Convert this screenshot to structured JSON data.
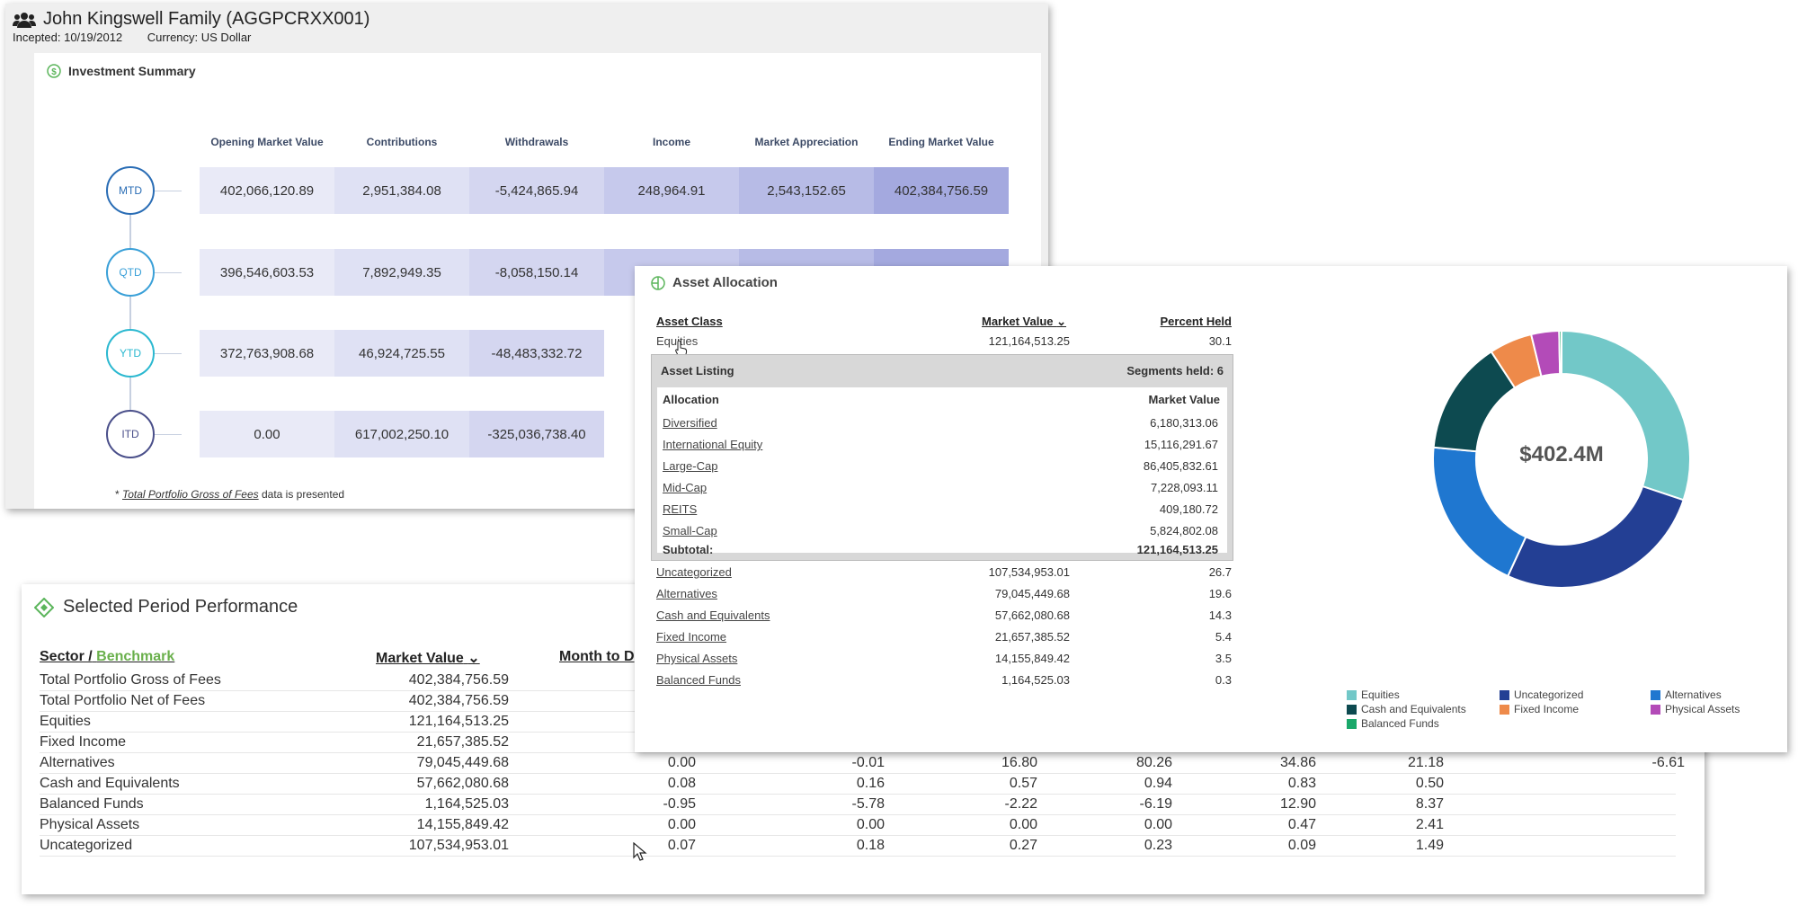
{
  "header": {
    "title": "John Kingswell Family (AGGPCRXX001)",
    "incepted": "Incepted: 10/19/2012",
    "currency": "Currency: US Dollar"
  },
  "investment_summary": {
    "title": "Investment Summary",
    "columns": [
      "Opening Market Value",
      "Contributions",
      "Withdrawals",
      "Income",
      "Market Appreciation",
      "Ending Market Value"
    ],
    "rows": [
      {
        "label": "MTD",
        "values": [
          "402,066,120.89",
          "2,951,384.08",
          "-5,424,865.94",
          "248,964.91",
          "2,543,152.65",
          "402,384,756.59"
        ]
      },
      {
        "label": "QTD",
        "values": [
          "396,546,603.53",
          "7,892,949.35",
          "-8,058,150.14"
        ]
      },
      {
        "label": "YTD",
        "values": [
          "372,763,908.68",
          "46,924,725.55",
          "-48,483,332.72"
        ]
      },
      {
        "label": "ITD",
        "values": [
          "0.00",
          "617,002,250.10",
          "-325,036,738.40"
        ]
      }
    ],
    "footnote_prefix": "* ",
    "footnote_link": "Total Portfolio Gross of Fees",
    "footnote_suffix": " data is presented"
  },
  "asset_allocation": {
    "title": "Asset Allocation",
    "headers": {
      "asset_class": "Asset Class",
      "market_value": "Market Value",
      "percent_held": "Percent Held"
    },
    "equities": {
      "name": "Equities",
      "mv": "121,164,513.25",
      "pct": "30.1"
    },
    "listing": {
      "title": "Asset Listing",
      "segments": "Segments held: 6",
      "col_alloc": "Allocation",
      "col_mv": "Market Value",
      "rows": [
        {
          "name": "Diversified",
          "mv": "6,180,313.06"
        },
        {
          "name": "International Equity",
          "mv": "15,116,291.67"
        },
        {
          "name": "Large-Cap",
          "mv": "86,405,832.61"
        },
        {
          "name": "Mid-Cap",
          "mv": "7,228,093.11"
        },
        {
          "name": "REITS",
          "mv": "409,180.72"
        },
        {
          "name": "Small-Cap",
          "mv": "5,824,802.08"
        }
      ],
      "subtotal_label": "Subtotal:",
      "subtotal_value": "121,164,513.25"
    },
    "rows": [
      {
        "name": "Uncategorized",
        "mv": "107,534,953.01",
        "pct": "26.7"
      },
      {
        "name": "Alternatives",
        "mv": "79,045,449.68",
        "pct": "19.6"
      },
      {
        "name": "Cash and Equivalents",
        "mv": "57,662,080.68",
        "pct": "14.3"
      },
      {
        "name": "Fixed Income",
        "mv": "21,657,385.52",
        "pct": "5.4"
      },
      {
        "name": "Physical Assets",
        "mv": "14,155,849.42",
        "pct": "3.5"
      },
      {
        "name": "Balanced Funds",
        "mv": "1,164,525.03",
        "pct": "0.3"
      }
    ],
    "donut_total": "$402.4M",
    "legend": [
      {
        "name": "Equities",
        "color": "#72c8c8"
      },
      {
        "name": "Uncategorized",
        "color": "#233f94"
      },
      {
        "name": "Alternatives",
        "color": "#1f77d0"
      },
      {
        "name": "Cash and Equivalents",
        "color": "#0d4a50"
      },
      {
        "name": "Fixed Income",
        "color": "#ee8a4a"
      },
      {
        "name": "Physical Assets",
        "color": "#b34bb8"
      },
      {
        "name": "Balanced Funds",
        "color": "#1aa86a"
      }
    ]
  },
  "chart_data": {
    "type": "pie",
    "categories": [
      "Equities",
      "Uncategorized",
      "Alternatives",
      "Cash and Equivalents",
      "Fixed Income",
      "Physical Assets",
      "Balanced Funds"
    ],
    "values": [
      30.1,
      26.7,
      19.6,
      14.3,
      5.4,
      3.5,
      0.3
    ],
    "colors": [
      "#72c8c8",
      "#233f94",
      "#1f77d0",
      "#0d4a50",
      "#ee8a4a",
      "#b34bb8",
      "#1aa86a"
    ],
    "center_label": "$402.4M",
    "legend_position": "bottom"
  },
  "performance": {
    "title": "Selected Period Performance",
    "col_sector": "Sector /",
    "col_benchmark": "Benchmark",
    "col_mv": "Market Value",
    "col_mtd": "Month to D",
    "rows": [
      {
        "name": "Total Portfolio Gross of Fees",
        "mv": "402,384,756.59",
        "v": []
      },
      {
        "name": "Total Portfolio Net of Fees",
        "mv": "402,384,756.59",
        "v": []
      },
      {
        "name": "Equities",
        "mv": "121,164,513.25",
        "v": []
      },
      {
        "name": "Fixed Income",
        "mv": "21,657,385.52",
        "v": []
      },
      {
        "name": "Alternatives",
        "mv": "79,045,449.68",
        "v": [
          "0.00",
          "-0.01",
          "16.80",
          "80.26",
          "34.86",
          "21.18",
          "-6.61"
        ]
      },
      {
        "name": "Cash and Equivalents",
        "mv": "57,662,080.68",
        "v": [
          "0.08",
          "0.16",
          "0.57",
          "0.94",
          "0.83",
          "0.50"
        ]
      },
      {
        "name": "Balanced Funds",
        "mv": "1,164,525.03",
        "v": [
          "-0.95",
          "-5.78",
          "-2.22",
          "-6.19",
          "12.90",
          "8.37"
        ]
      },
      {
        "name": "Physical Assets",
        "mv": "14,155,849.42",
        "v": [
          "0.00",
          "0.00",
          "0.00",
          "0.00",
          "0.47",
          "2.41"
        ]
      },
      {
        "name": "Uncategorized",
        "mv": "107,534,953.01",
        "v": [
          "0.07",
          "0.18",
          "0.27",
          "0.23",
          "0.09",
          "1.49"
        ]
      }
    ]
  }
}
